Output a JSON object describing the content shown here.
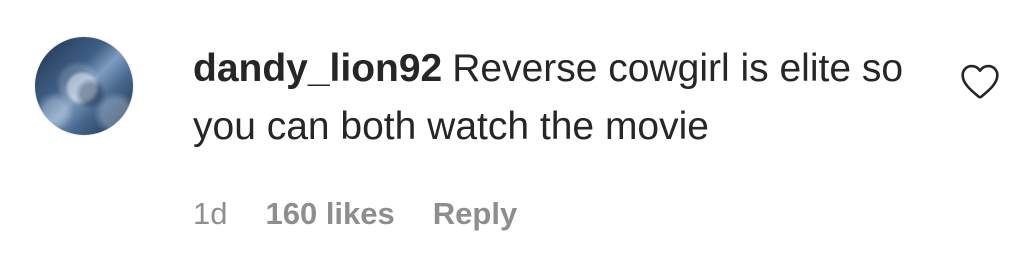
{
  "comment": {
    "username": "dandy_lion92",
    "text": "Reverse cowgirl is elite so you can both watch the movie"
  },
  "meta": {
    "time": "1d",
    "likes": "160 likes",
    "reply": "Reply"
  },
  "icons": {
    "avatar": "avatar-photo",
    "heart": "heart-outline-icon"
  },
  "colors": {
    "text": "#262626",
    "secondary": "#8e8e8e",
    "background": "#ffffff"
  }
}
